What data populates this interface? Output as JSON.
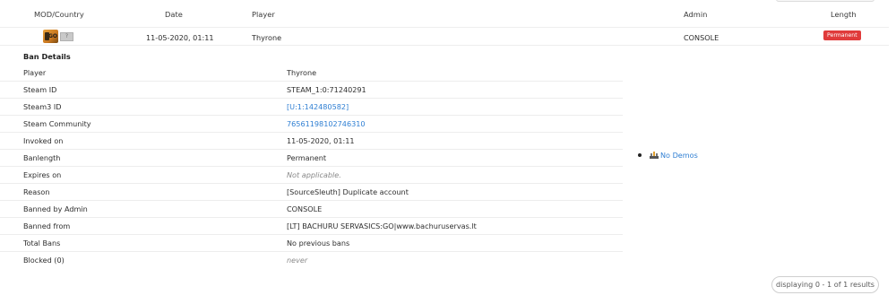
{
  "header": {
    "mod_country": "MOD/Country",
    "date": "Date",
    "player": "Player",
    "admin": "Admin",
    "length": "Length"
  },
  "ban_row": {
    "mod_icon": "csgo-icon",
    "mod_icon_text": "GO",
    "flag_icon": "unknown-flag-icon",
    "flag_text": "?",
    "date": "11-05-2020, 01:11",
    "player": "Thyrone",
    "admin": "CONSOLE",
    "length": "Permanent",
    "length_color": "#e03b3b"
  },
  "details": {
    "title": "Ban Details",
    "rows": [
      {
        "label": "Player",
        "value": "Thyrone",
        "style": "normal"
      },
      {
        "label": "Steam ID",
        "value": "STEAM_1:0:71240291",
        "style": "normal"
      },
      {
        "label": "Steam3 ID",
        "value": "[U:1:142480582]",
        "style": "link"
      },
      {
        "label": "Steam Community",
        "value": "76561198102746310",
        "style": "link"
      },
      {
        "label": "Invoked on",
        "value": "11-05-2020, 01:11",
        "style": "normal"
      },
      {
        "label": "Banlength",
        "value": "Permanent",
        "style": "normal"
      },
      {
        "label": "Expires on",
        "value": "Not applicable.",
        "style": "muted"
      },
      {
        "label": "Reason",
        "value": "[SourceSleuth] Duplicate account",
        "style": "normal"
      },
      {
        "label": "Banned by Admin",
        "value": "CONSOLE",
        "style": "normal"
      },
      {
        "label": "Banned from",
        "value": "[LT] BACHURU SERVASICS:GO|www.bachuruservas.lt",
        "style": "normal"
      },
      {
        "label": "Total Bans",
        "value": "No previous bans",
        "style": "normal"
      },
      {
        "label": "Blocked (0)",
        "value": "never",
        "style": "muted"
      }
    ]
  },
  "demos": {
    "icon": "demo-icon",
    "label": "No Demos"
  },
  "pagination": {
    "text": "displaying 0 - 1 of 1 results"
  },
  "colors": {
    "link": "#2f7fd3",
    "badge": "#e03b3b",
    "border": "#ededed"
  }
}
